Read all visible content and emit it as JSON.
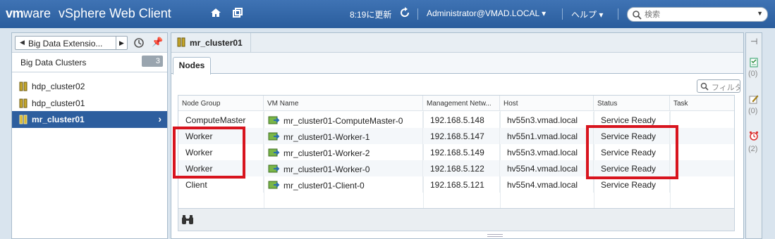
{
  "header": {
    "brand_vm": "vm",
    "brand_ware": "ware",
    "product": "vSphere Web Client",
    "refresh_time": "8:19に更新",
    "user": "Administrator@VMAD.LOCAL",
    "help": "ヘルプ",
    "search_placeholder": "検索",
    "icons": [
      "home-icon",
      "windows-icon",
      "refresh-icon",
      "search-icon"
    ]
  },
  "left_panel": {
    "nav_label": "Big Data Extensio...",
    "title": "Big Data Clusters",
    "count": "3",
    "items": [
      {
        "label": "hdp_cluster02",
        "selected": false
      },
      {
        "label": "hdp_cluster01",
        "selected": false
      },
      {
        "label": "mr_cluster01",
        "selected": true
      }
    ]
  },
  "main": {
    "title": "mr_cluster01",
    "tab": "Nodes",
    "filter_placeholder": "フィルタ",
    "columns": [
      "Node Group",
      "VM Name",
      "Management Netw...",
      "Host",
      "Status",
      "Task"
    ],
    "rows": [
      {
        "group": "ComputeMaster",
        "vm": "mr_cluster01-ComputeMaster-0",
        "ip": "192.168.5.148",
        "host": "hv55n3.vmad.local",
        "status": "Service Ready",
        "task": ""
      },
      {
        "group": "Worker",
        "vm": "mr_cluster01-Worker-1",
        "ip": "192.168.5.147",
        "host": "hv55n1.vmad.local",
        "status": "Service Ready",
        "task": ""
      },
      {
        "group": "Worker",
        "vm": "mr_cluster01-Worker-2",
        "ip": "192.168.5.149",
        "host": "hv55n3.vmad.local",
        "status": "Service Ready",
        "task": ""
      },
      {
        "group": "Worker",
        "vm": "mr_cluster01-Worker-0",
        "ip": "192.168.5.122",
        "host": "hv55n4.vmad.local",
        "status": "Service Ready",
        "task": ""
      },
      {
        "group": "Client",
        "vm": "mr_cluster01-Client-0",
        "ip": "192.168.5.121",
        "host": "hv55n4.vmad.local",
        "status": "Service Ready",
        "task": ""
      }
    ]
  },
  "right_bar": {
    "tasks_count": "(0)",
    "alarms_count": "(0)",
    "work_count": "(2)"
  },
  "colors": {
    "header": "#2f64a6",
    "selection": "#2d5e9e",
    "highlight": "#d8141e"
  }
}
